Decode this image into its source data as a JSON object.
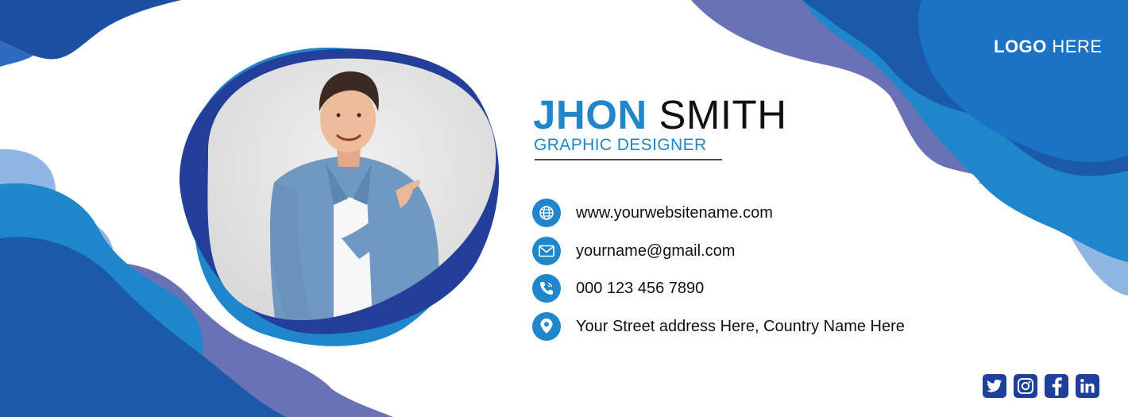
{
  "logo": {
    "bold": "LOGO",
    "light": " HERE",
    "icon": "logo-placeholder"
  },
  "profile": {
    "first_name": "JHON",
    "last_name": " SMITH",
    "job_title": "GRAPHIC DESIGNER",
    "photo": "person-pointing-photo"
  },
  "contacts": [
    {
      "icon": "globe-icon",
      "text": "www.yourwebsitename.com"
    },
    {
      "icon": "envelope-icon",
      "text": "yourname@gmail.com"
    },
    {
      "icon": "phone-icon",
      "text": "000 123 456 7890"
    },
    {
      "icon": "location-pin-icon",
      "text": "Your Street address Here, Country Name Here"
    }
  ],
  "social": [
    "twitter-icon",
    "instagram-icon",
    "facebook-icon",
    "linkedin-icon"
  ],
  "colors": {
    "accent": "#1f86cc",
    "dark_blue": "#1b4fa3",
    "navy": "#233f9b",
    "purple": "#6872b5",
    "light_blue": "#8fb6e3",
    "text": "#111111"
  }
}
